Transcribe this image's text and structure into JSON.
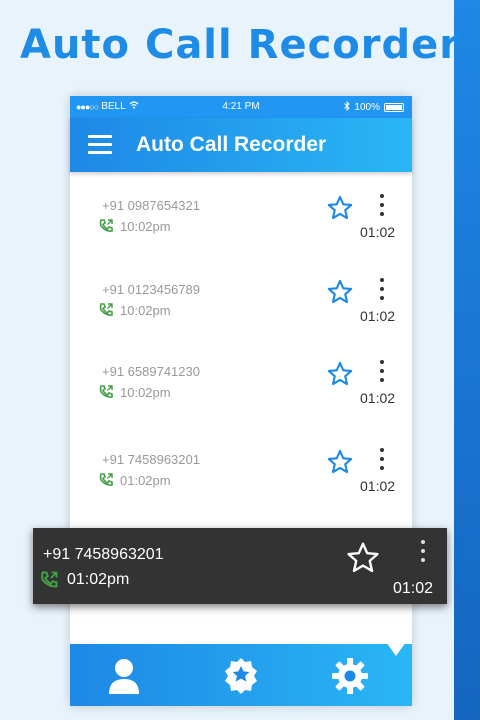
{
  "headline": "Auto Call Recorder",
  "status_bar": {
    "carrier": "BELL",
    "time": "4:21 PM",
    "battery": "100%"
  },
  "app_bar": {
    "title": "Auto Call Recorder"
  },
  "records": [
    {
      "number": "+91 0987654321",
      "time": "10:02pm",
      "duration": "01:02"
    },
    {
      "number": "+91 0123456789",
      "time": "10:02pm",
      "duration": "01:02"
    },
    {
      "number": "+91 6589741230",
      "time": "10:02pm",
      "duration": "01:02"
    },
    {
      "number": "+91 7458963201",
      "time": "01:02pm",
      "duration": "01:02"
    }
  ],
  "popup": {
    "number": "+91 7458963201",
    "time": "01:02pm",
    "duration": "01:02"
  },
  "bottom_nav": {
    "items": [
      "contacts-icon",
      "badge-icon",
      "settings-icon"
    ]
  },
  "colors": {
    "primary": "#1e88e5",
    "accent": "#29b6f6",
    "call_icon": "#43a047",
    "popup_bg": "#333334"
  }
}
